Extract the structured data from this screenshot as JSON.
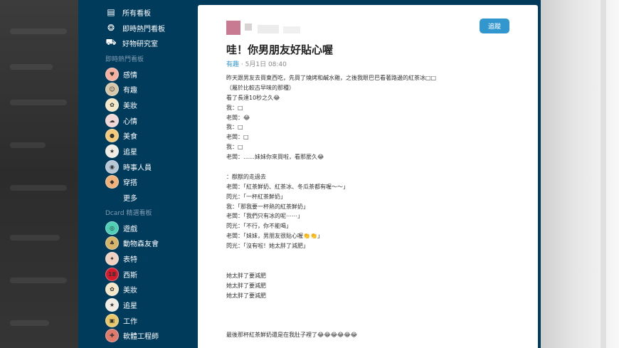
{
  "sidebar": {
    "top_items": [
      {
        "icon": "board-list-icon",
        "glyph": "▤",
        "label": "所有看板"
      },
      {
        "icon": "fire-icon",
        "glyph": "❂",
        "label": "即時熱門看板"
      },
      {
        "icon": "cart-icon",
        "glyph": "⛟",
        "label": "好物研究室"
      }
    ],
    "hot_section_label": "即時熱門看板",
    "hot_boards": [
      {
        "label": "感情",
        "avatar_color": "#f7b0a0",
        "avatar_text": "♥"
      },
      {
        "label": "有趣",
        "avatar_color": "#d8c7a8",
        "avatar_text": "☺"
      },
      {
        "label": "美妝",
        "avatar_color": "#f5e7c8",
        "avatar_text": "✿"
      },
      {
        "label": "心情",
        "avatar_color": "#f3d6d6",
        "avatar_text": "☁"
      },
      {
        "label": "美食",
        "avatar_color": "#f5c97a",
        "avatar_text": "●"
      },
      {
        "label": "追星",
        "avatar_color": "#f1ede4",
        "avatar_text": "★"
      },
      {
        "label": "時事人員",
        "avatar_color": "#b8c7d5",
        "avatar_text": "◉"
      },
      {
        "label": "穿搭",
        "avatar_color": "#f0b27a",
        "avatar_text": "◆"
      }
    ],
    "more_label": "更多",
    "selected_section_label": "Dcard 精選看板",
    "selected_boards": [
      {
        "label": "遊戲",
        "avatar_color": "#4fcfb5",
        "avatar_text": "◎"
      },
      {
        "label": "動物森友會",
        "avatar_color": "#d6b56a",
        "avatar_text": "♣"
      },
      {
        "label": "表特",
        "avatar_color": "#f1d1c2",
        "avatar_text": "✦"
      },
      {
        "label": "西斯",
        "avatar_color": "#d81b2c",
        "avatar_text": "18"
      },
      {
        "label": "美妝",
        "avatar_color": "#f5e7c8",
        "avatar_text": "✿"
      },
      {
        "label": "追星",
        "avatar_color": "#f1ede4",
        "avatar_text": "★"
      },
      {
        "label": "工作",
        "avatar_color": "#e8c86a",
        "avatar_text": "▣"
      },
      {
        "label": "軟體工程師",
        "avatar_color": "#e07a6a",
        "avatar_text": "✚"
      }
    ]
  },
  "post": {
    "follow_label": "追蹤",
    "title": "哇！你男朋友好貼心喔",
    "topic": "有趣",
    "date": "5月1日 08:40",
    "lines": [
      "昨天跟男友去買東西吃，先買了燒烤和鹹水雞，之後我眼巴巴看著路邊的紅茶冰□□",
      "（屬於比較古早味的那種）",
      "看了長達10秒之久😂",
      "我：□",
      "老闆：😂",
      "我：□",
      "老闆：□",
      "我：□",
      "老闆：……妹妹你來買啦，看那麼久😂",
      "",
      "：猷猷的走過去",
      "老闆：「紅茶鮮奶、紅茶冰、冬瓜茶都有喔～～」",
      "閃光：「一杯紅茶鮮奶」",
      "我：「那我要一杯熱的紅茶鮮奶」",
      "老闆：「我們只有冰的呢⋯⋯」",
      "閃光：「不行，你不能喝」",
      "老闆：「妹妹，男朋友很貼心喔👏👏」",
      "閃光：「沒有啦！她太胖了減肥」",
      "",
      "",
      "她太胖了要減肥",
      "她太胖了要減肥",
      "她太胖了要減肥",
      "",
      "",
      "",
      "最後那杯紅茶鮮奶還是在我肚子裡了😂😂😂😂😂😂"
    ]
  },
  "colors": {
    "app_bg": "#013b5c",
    "accent": "#3397cf"
  }
}
